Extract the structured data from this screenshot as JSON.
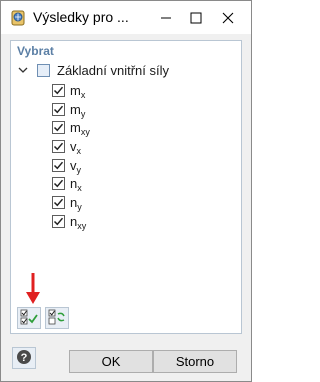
{
  "window": {
    "title": "Výsledky pro ..."
  },
  "panel": {
    "group_title": "Vybrat",
    "parent": {
      "label": "Základní vnitřní síly",
      "checked": "partial"
    },
    "items": [
      {
        "base": "m",
        "sub": "x",
        "checked": true
      },
      {
        "base": "m",
        "sub": "y",
        "checked": true
      },
      {
        "base": "m",
        "sub": "xy",
        "checked": true
      },
      {
        "base": "v",
        "sub": "x",
        "checked": true
      },
      {
        "base": "v",
        "sub": "y",
        "checked": true
      },
      {
        "base": "n",
        "sub": "x",
        "checked": true
      },
      {
        "base": "n",
        "sub": "y",
        "checked": true
      },
      {
        "base": "n",
        "sub": "xy",
        "checked": true
      }
    ]
  },
  "footer": {
    "ok_label": "OK",
    "cancel_label": "Storno"
  },
  "colors": {
    "accent": "#5b7fa5",
    "arrow": "#e02020",
    "panel_border": "#b9c6d3"
  },
  "icons": {
    "app": "app-globe-icon",
    "check_all": "check-all-icon",
    "toggle": "toggle-selection-icon",
    "help": "help-icon",
    "arrow": "red-arrow-icon"
  }
}
